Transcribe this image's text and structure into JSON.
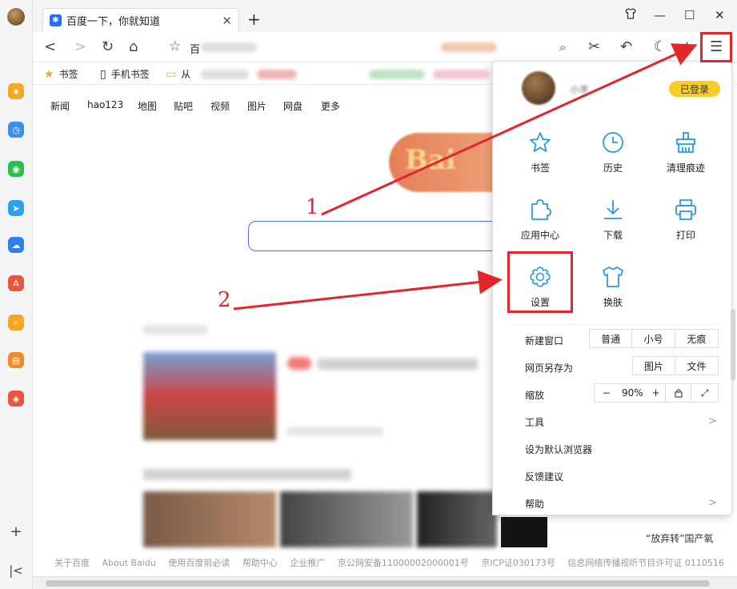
{
  "browser": {
    "tab_title": "百度一下，你就知道",
    "new_tab_symbol": "+",
    "close_symbol": "✕",
    "address_text": "百",
    "window_controls": [
      "tshirt-icon",
      "minimize-icon",
      "maximize-icon",
      "close-icon"
    ]
  },
  "bookmarks": {
    "items": [
      "书签",
      "手机书签",
      "从"
    ]
  },
  "page": {
    "topnav": [
      "新闻",
      "hao123",
      "地图",
      "贴吧",
      "视频",
      "图片",
      "网盘",
      "更多"
    ],
    "logo_text": "Bai",
    "footer": [
      "关于百度",
      "About Baidu",
      "使用百度前必读",
      "帮助中心",
      "企业推广",
      "京公网安备11000002000001号",
      "京ICP证030173号",
      "信息网络传播视听节目许可证 0110516"
    ],
    "side_snippets": [
      "“放弃转”国产氧"
    ]
  },
  "menu": {
    "user_name": "小羊",
    "login_badge": "已登录",
    "grid": [
      "书签",
      "历史",
      "清理痕迹",
      "应用中心",
      "下载",
      "打印",
      "设置",
      "换肤"
    ],
    "new_window_label": "新建窗口",
    "new_window_options": [
      "普通",
      "小号",
      "无痕"
    ],
    "save_as_label": "网页另存为",
    "save_as_options": [
      "图片",
      "文件"
    ],
    "zoom_label": "缩放",
    "zoom_minus": "−",
    "zoom_value": "90%",
    "zoom_plus": "+",
    "tools_label": "工具",
    "default_browser_label": "设为默认浏览器",
    "feedback_label": "反馈建议",
    "help_label": "帮助"
  },
  "annotations": {
    "label_1": "1",
    "label_2": "2",
    "color": "#e3262b"
  },
  "colors": {
    "accent_blue": "#2b6cf0",
    "login_yellow": "#f8cd2a",
    "menu_icon_blue": "#2a9be0"
  }
}
